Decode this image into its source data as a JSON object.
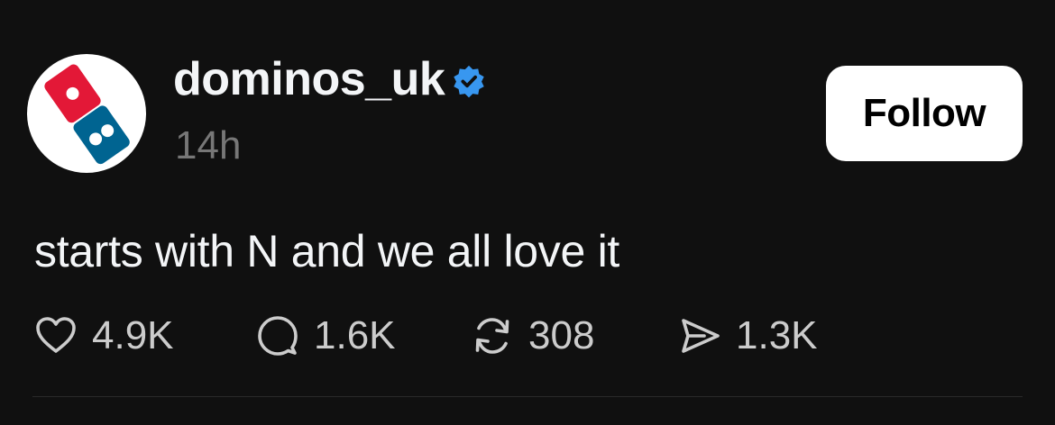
{
  "post": {
    "author": {
      "username": "dominos_uk",
      "avatar_icon": "dominos-logo-icon",
      "verified_icon": "verified-badge-icon",
      "verified_color": "#3897f0"
    },
    "timestamp": "14h",
    "follow_label": "Follow",
    "text": "starts with N and we all love it",
    "actions": {
      "like": {
        "icon": "heart-icon",
        "count": "4.9K"
      },
      "reply": {
        "icon": "comment-icon",
        "count": "1.6K"
      },
      "repost": {
        "icon": "repost-icon",
        "count": "308"
      },
      "share": {
        "icon": "send-icon",
        "count": "1.3K"
      }
    }
  },
  "colors": {
    "background": "#101010",
    "text": "#f3f5f7",
    "muted": "#777777",
    "brand_red": "#e31837",
    "brand_blue": "#006491"
  }
}
